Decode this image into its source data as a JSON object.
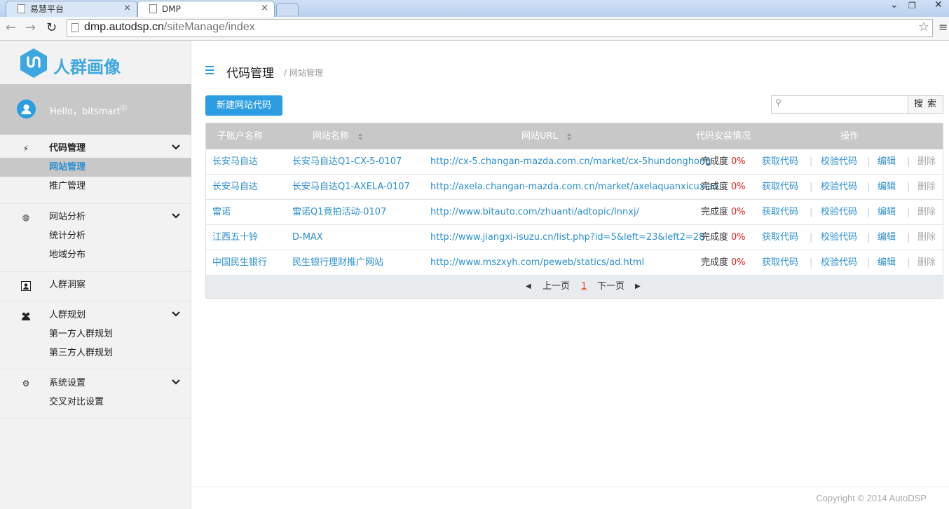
{
  "browser": {
    "tabs": [
      {
        "title": "易慧平台",
        "close": "×"
      },
      {
        "title": "DMP",
        "close": "×"
      }
    ],
    "url_host": "dmp.autodsp.cn",
    "url_path": "/siteManage/index",
    "icons": [
      "back-icon",
      "forward-icon",
      "reload-icon",
      "star-icon",
      "menu-icon",
      "minimize-icon",
      "maximize-icon",
      "close-icon"
    ]
  },
  "sidebar": {
    "logo_text": "人群画像",
    "user": {
      "hello": "Hello，bitsmart"
    },
    "groups": [
      {
        "label": "代码管理",
        "icon": "flash-icon",
        "items": [
          "网站管理",
          "推广管理"
        ],
        "active": 0
      },
      {
        "label": "网站分析",
        "icon": "globe-icon",
        "items": [
          "统计分析",
          "地域分布"
        ]
      },
      {
        "label": "人群洞察",
        "icon": "person-card-icon",
        "items": []
      },
      {
        "label": "人群规划",
        "icon": "people-icon",
        "items": [
          "第一方人群规划",
          "第三方人群规划"
        ]
      },
      {
        "label": "系统设置",
        "icon": "gear-icon",
        "items": [
          "交叉对比设置"
        ]
      }
    ]
  },
  "main": {
    "title": "代码管理",
    "breadcrumb": "/ 网站管理",
    "new_button": "新建网站代码",
    "search_button": "搜索",
    "search_value": "",
    "table": {
      "headers": [
        "子账户名称",
        "网站名称",
        "网站URL",
        "代码安装情况",
        "操作"
      ],
      "rows": [
        {
          "account": "长安马自达",
          "site": "长安马自达Q1-CX-5-0107",
          "url": "http://cx-5.changan-mazda.com.cn/market/cx-5hundonghong",
          "status_label": "完成度",
          "pct": "0%"
        },
        {
          "account": "长安马自达",
          "site": "长安马自达Q1-AXELA-0107",
          "url": "http://axela.changan-mazda.com.cn/market/axelaquanxicuxiao",
          "status_label": "完成度",
          "pct": "0%"
        },
        {
          "account": "雷诺",
          "site": "雷诺Q1竟拍活动-0107",
          "url": "http://www.bitauto.com/zhuanti/adtopic/lnnxj/",
          "status_label": "完成度",
          "pct": "0%"
        },
        {
          "account": "江西五十铃",
          "site": "D-MAX",
          "url": "http://www.jiangxi-isuzu.cn/list.php?id=5&left=23&left2=28",
          "status_label": "完成度",
          "pct": "0%"
        },
        {
          "account": "中国民生银行",
          "site": "民生银行理财推广网站",
          "url": "http://www.mszxyh.com/peweb/statics/ad.html",
          "status_label": "完成度",
          "pct": "0%"
        }
      ],
      "actions": [
        "获取代码",
        "校验代码",
        "编辑",
        "删除"
      ]
    },
    "pager": {
      "prev": "上一页",
      "current": "1",
      "next": "下一页"
    },
    "footer": "Copyright © 2014 AutoDSP"
  },
  "colors": {
    "accent": "#2b9de0",
    "link": "#2b8fcf",
    "percent": "#e02020",
    "header_gray": "#c8c8c8"
  }
}
